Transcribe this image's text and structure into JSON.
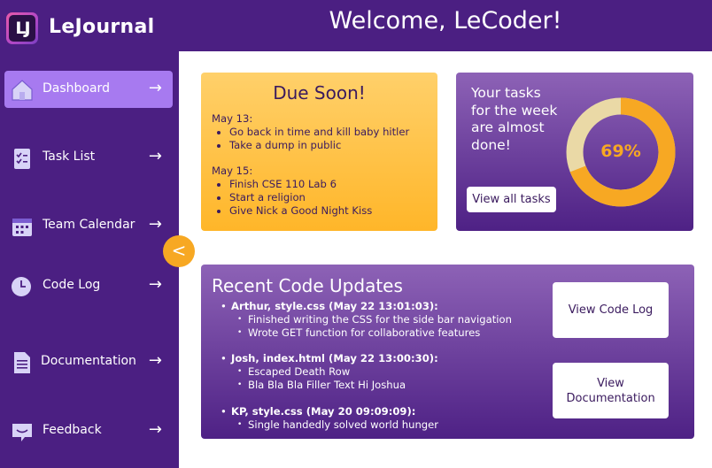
{
  "app": {
    "title": "LeJournal",
    "logo_text": "LJ"
  },
  "header": {
    "welcome": "Welcome, LeCoder!"
  },
  "sidebar": {
    "items": [
      {
        "label": "Dashboard",
        "icon": "home-icon",
        "active": true
      },
      {
        "label": "Task List",
        "icon": "checklist-icon"
      },
      {
        "label": "Team Calendar",
        "icon": "calendar-icon"
      },
      {
        "label": "Code Log",
        "icon": "clock-icon"
      },
      {
        "label": "Documentation",
        "icon": "document-icon"
      },
      {
        "label": "Feedback",
        "icon": "feedback-icon"
      }
    ],
    "arrow": "→",
    "collapse_glyph": "<"
  },
  "due_soon": {
    "title": "Due Soon!",
    "groups": [
      {
        "date": "May 13:",
        "items": [
          "Go back in time and kill baby hitler",
          "Take a dump in public"
        ]
      },
      {
        "date": "May 15:",
        "items": [
          "Finish CSE 110 Lab 6",
          "Start a religion",
          "Give Nick a Good Night Kiss"
        ]
      }
    ]
  },
  "tasks": {
    "text": "Your tasks for the week are almost done!",
    "button": "View all tasks",
    "percent_label": "69%",
    "percent_value": 0.69
  },
  "code_updates": {
    "title": "Recent Code Updates",
    "entries": [
      {
        "head": "Arthur, style.css (May 22 13:01:03):",
        "items": [
          "Finished writing the CSS for the side bar navigation",
          "Wrote GET function for collaborative features"
        ]
      },
      {
        "head": "Josh, index.html (May 22 13:00:30):",
        "items": [
          "Escaped Death Row",
          "Bla Bla Bla Filler Text Hi Joshua"
        ]
      },
      {
        "head": "KP, style.css (May 20 09:09:09):",
        "items": [
          "Single handedly solved world hunger"
        ]
      }
    ],
    "view_code_log": "View Code Log",
    "view_documentation": "View Documentation"
  },
  "colors": {
    "purple": "#4b1f82",
    "accent": "#a77af0",
    "orange": "#f7a823",
    "donut_track": "#ead9a6"
  }
}
